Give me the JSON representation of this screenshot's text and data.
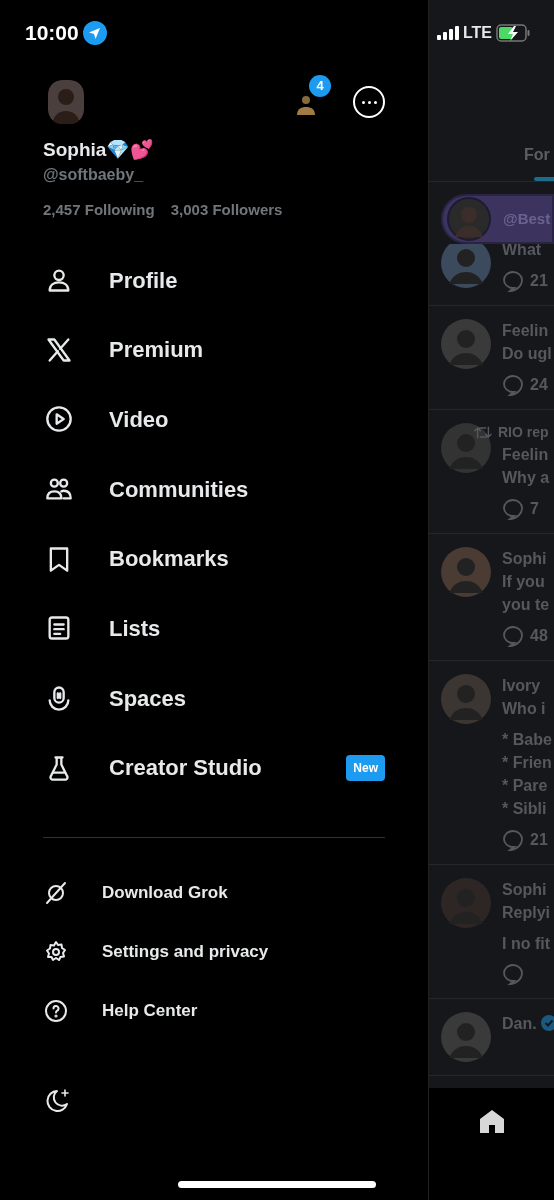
{
  "status_bar": {
    "time": "10:00",
    "network": "LTE"
  },
  "profile": {
    "name": "Sophia💎💕",
    "handle": "@softbaeby_",
    "following": "**2,457** Following",
    "followers": "**3,003** Followers",
    "account_badge": "4"
  },
  "menu": [
    {
      "label": "Profile"
    },
    {
      "label": "Premium"
    },
    {
      "label": "Video"
    },
    {
      "label": "Communities"
    },
    {
      "label": "Bookmarks"
    },
    {
      "label": "Lists"
    },
    {
      "label": "Spaces"
    },
    {
      "label": "Creator Studio",
      "badge": "New"
    }
  ],
  "secondary_menu": [
    {
      "label": "Download Grok"
    },
    {
      "label": "Settings and privacy"
    },
    {
      "label": "Help Center"
    }
  ],
  "feed": {
    "tab": "For",
    "chip": "@Best",
    "posts": [
      {
        "paragraphs": [
          [
            "What"
          ]
        ],
        "count": "21"
      },
      {
        "paragraphs": [
          [
            "Feelin",
            "Do ugl"
          ]
        ],
        "count": "24"
      },
      {
        "retweet": "RIO rep",
        "paragraphs": [
          [
            "Feelin",
            "Why a"
          ]
        ],
        "count": "7"
      },
      {
        "paragraphs": [
          [
            "Sophi",
            "If you",
            "you te"
          ]
        ],
        "count": "48"
      },
      {
        "paragraphs": [
          [
            "Ivory",
            "Who i"
          ],
          [
            "* Babe",
            "* Frien",
            "* Pare",
            "* Sibli"
          ]
        ],
        "count": "21"
      },
      {
        "paragraphs": [
          [
            "Sophi",
            "Replyi"
          ],
          [
            "I no fit"
          ]
        ]
      },
      {
        "paragraphs": [
          [
            "Dan."
          ]
        ],
        "verified": true
      }
    ]
  }
}
